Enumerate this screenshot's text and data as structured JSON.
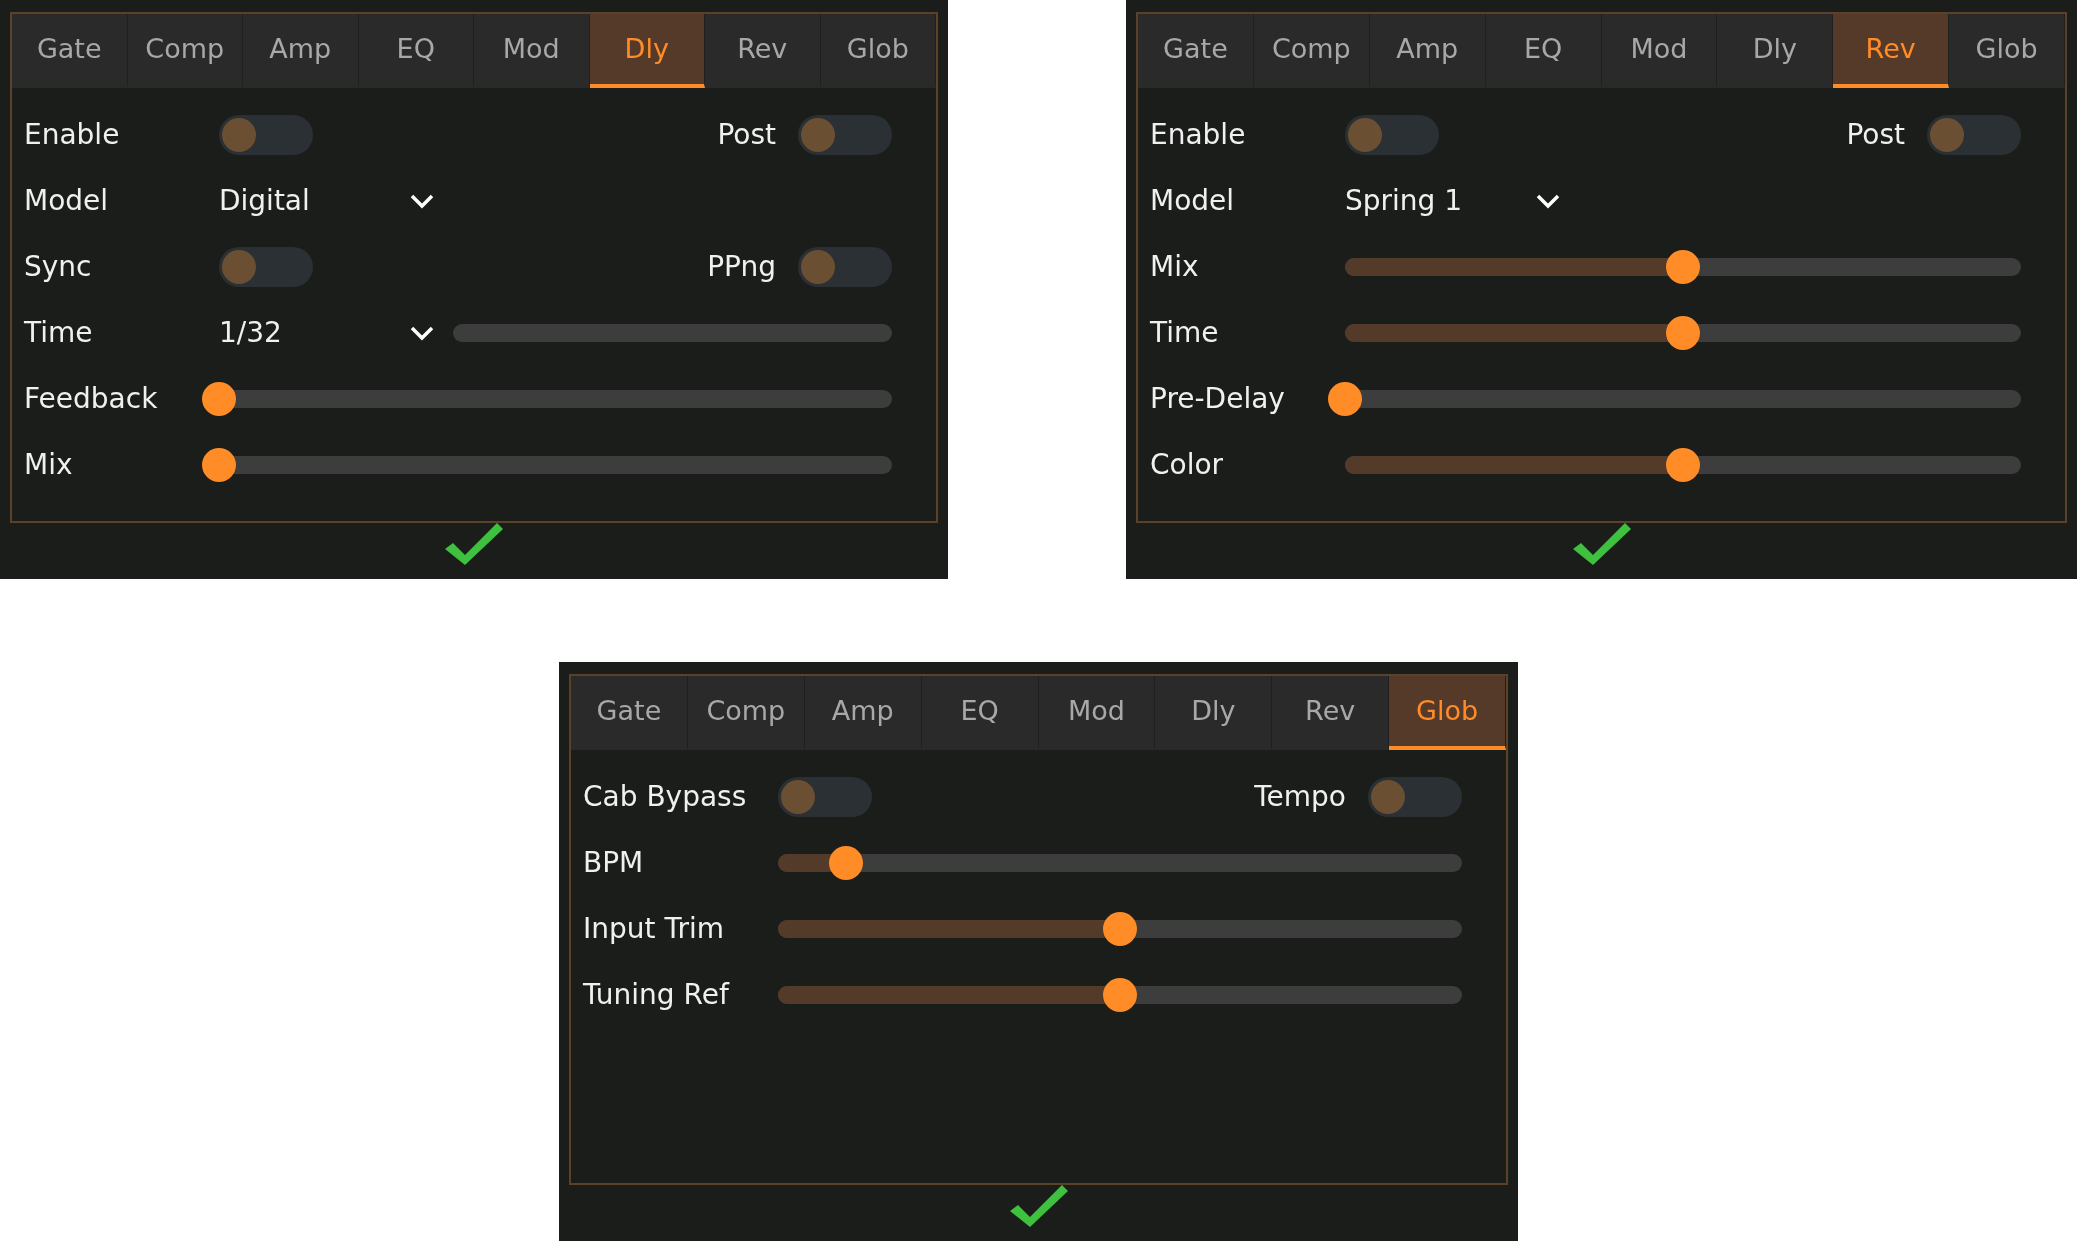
{
  "panels": [
    {
      "tabs": [
        {
          "label": "Gate",
          "selected": false
        },
        {
          "label": "Comp",
          "selected": false
        },
        {
          "label": "Amp",
          "selected": false
        },
        {
          "label": "EQ",
          "selected": false
        },
        {
          "label": "Mod",
          "selected": false
        },
        {
          "label": "Dly",
          "selected": true
        },
        {
          "label": "Rev",
          "selected": false
        },
        {
          "label": "Glob",
          "selected": false
        }
      ],
      "rows": [
        {
          "kind": "toggles",
          "label": "Enable",
          "on": false,
          "right_label": "Post",
          "right_on": false
        },
        {
          "kind": "select",
          "label": "Model",
          "value": "Digital"
        },
        {
          "kind": "toggles",
          "label": "Sync",
          "on": false,
          "right_label": "PPng",
          "right_on": false
        },
        {
          "kind": "select_track",
          "label": "Time",
          "value": "1/32"
        },
        {
          "kind": "slider",
          "label": "Feedback",
          "level": 0
        },
        {
          "kind": "slider",
          "label": "Mix",
          "level": 0
        }
      ]
    },
    {
      "tabs": [
        {
          "label": "Gate",
          "selected": false
        },
        {
          "label": "Comp",
          "selected": false
        },
        {
          "label": "Amp",
          "selected": false
        },
        {
          "label": "EQ",
          "selected": false
        },
        {
          "label": "Mod",
          "selected": false
        },
        {
          "label": "Dly",
          "selected": false
        },
        {
          "label": "Rev",
          "selected": true
        },
        {
          "label": "Glob",
          "selected": false
        }
      ],
      "rows": [
        {
          "kind": "toggles",
          "label": "Enable",
          "on": false,
          "right_label": "Post",
          "right_on": false
        },
        {
          "kind": "select",
          "label": "Model",
          "value": "Spring 1"
        },
        {
          "kind": "slider",
          "label": "Mix",
          "level": 0.5
        },
        {
          "kind": "slider",
          "label": "Time",
          "level": 0.5
        },
        {
          "kind": "slider",
          "label": "Pre-Delay",
          "level": 0
        },
        {
          "kind": "slider",
          "label": "Color",
          "level": 0.5
        }
      ]
    },
    {
      "tabs": [
        {
          "label": "Gate",
          "selected": false
        },
        {
          "label": "Comp",
          "selected": false
        },
        {
          "label": "Amp",
          "selected": false
        },
        {
          "label": "EQ",
          "selected": false
        },
        {
          "label": "Mod",
          "selected": false
        },
        {
          "label": "Dly",
          "selected": false
        },
        {
          "label": "Rev",
          "selected": false
        },
        {
          "label": "Glob",
          "selected": true
        }
      ],
      "rows": [
        {
          "kind": "toggles",
          "label": "Cab Bypass",
          "on": false,
          "right_label": "Tempo",
          "right_on": false
        },
        {
          "kind": "slider",
          "label": "BPM",
          "level": 0.1
        },
        {
          "kind": "slider",
          "label": "Input Trim",
          "level": 0.5
        },
        {
          "kind": "slider",
          "label": "Tuning Ref",
          "level": 0.5
        }
      ]
    }
  ]
}
